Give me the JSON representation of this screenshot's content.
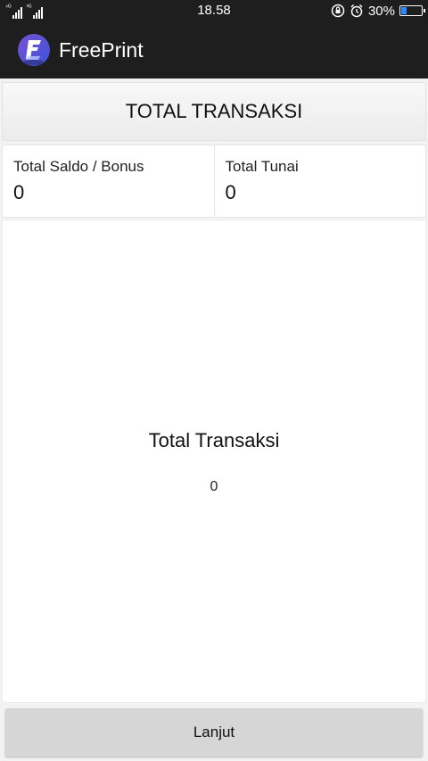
{
  "status_bar": {
    "network_label": "4G|3G",
    "time": "18.58",
    "battery_percent": "30%",
    "battery_level": 0.3,
    "icons": [
      "signal-icon",
      "lock-rotation-icon",
      "alarm-icon",
      "battery-icon"
    ]
  },
  "app_bar": {
    "title": "FreePrint",
    "logo_icon": "freeprint-logo-icon",
    "background": "#1e1e1e"
  },
  "header": {
    "label": "TOTAL TRANSAKSI"
  },
  "totals": {
    "saldo_label": "Total Saldo / Bonus",
    "saldo_value": "0",
    "tunai_label": "Total Tunai",
    "tunai_value": "0"
  },
  "summary": {
    "title": "Total Transaksi",
    "value": "0"
  },
  "footer": {
    "next_label": "Lanjut"
  },
  "colors": {
    "app_bar": "#1e1e1e",
    "logo_accent": "#4a5be0",
    "battery_accent": "#2f8cff",
    "button_bg": "#d6d6d6"
  }
}
